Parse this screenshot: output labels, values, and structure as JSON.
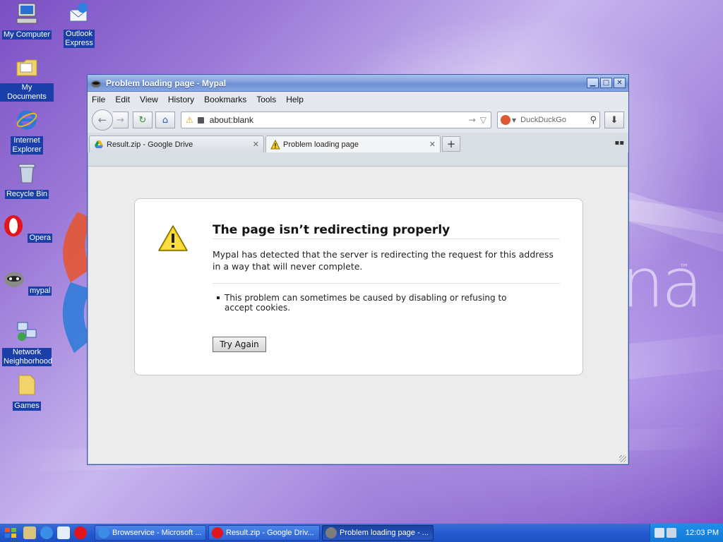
{
  "desktop": {
    "icons": [
      {
        "label": "My Computer",
        "icon": "computer-icon"
      },
      {
        "label": "Outlook Express",
        "icon": "outlook-express-icon"
      },
      {
        "label": "My Documents",
        "icon": "folder-icon"
      },
      {
        "label": "Internet Explorer",
        "icon": "internet-explorer-icon"
      },
      {
        "label": "Recycle Bin",
        "icon": "recycle-bin-icon"
      },
      {
        "label": "Opera",
        "icon": "opera-icon"
      },
      {
        "label": "mypal",
        "icon": "mypal-icon"
      },
      {
        "label": "Network Neighborhood",
        "icon": "network-icon"
      },
      {
        "label": "Games",
        "icon": "games-folder-icon"
      }
    ],
    "wallpaper_text": "na",
    "wallpaper_tm": "™"
  },
  "window": {
    "title": "Problem loading page - Mypal",
    "menu": [
      "File",
      "Edit",
      "View",
      "History",
      "Bookmarks",
      "Tools",
      "Help"
    ],
    "url": "about:blank",
    "search_placeholder": "DuckDuckGo",
    "tabs": [
      {
        "label": "Result.zip - Google Drive",
        "icon": "google-drive-icon",
        "active": false
      },
      {
        "label": "Problem loading page",
        "icon": "warning-icon",
        "active": true
      }
    ]
  },
  "error": {
    "title": "The page isn’t redirecting properly",
    "description": "Mypal has detected that the server is redirecting the request for this address in a way that will never complete.",
    "bullet": "This problem can sometimes be caused by disabling or refusing to accept cookies.",
    "button": "Try Again"
  },
  "taskbar": {
    "buttons": [
      {
        "label": "Browservice - Microsoft ...",
        "icon": "internet-explorer-icon",
        "active": false
      },
      {
        "label": "Result.zip - Google Driv...",
        "icon": "opera-icon",
        "active": false
      },
      {
        "label": "Problem loading page - ...",
        "icon": "mypal-icon",
        "active": true
      }
    ],
    "clock": "12:03 PM"
  },
  "colors": {
    "wallpaper_purple": "#9c7ad8",
    "titlebar_blue": "#7f9fdb",
    "taskbar_blue": "#245bd0",
    "warning_yellow": "#f5d20b"
  }
}
